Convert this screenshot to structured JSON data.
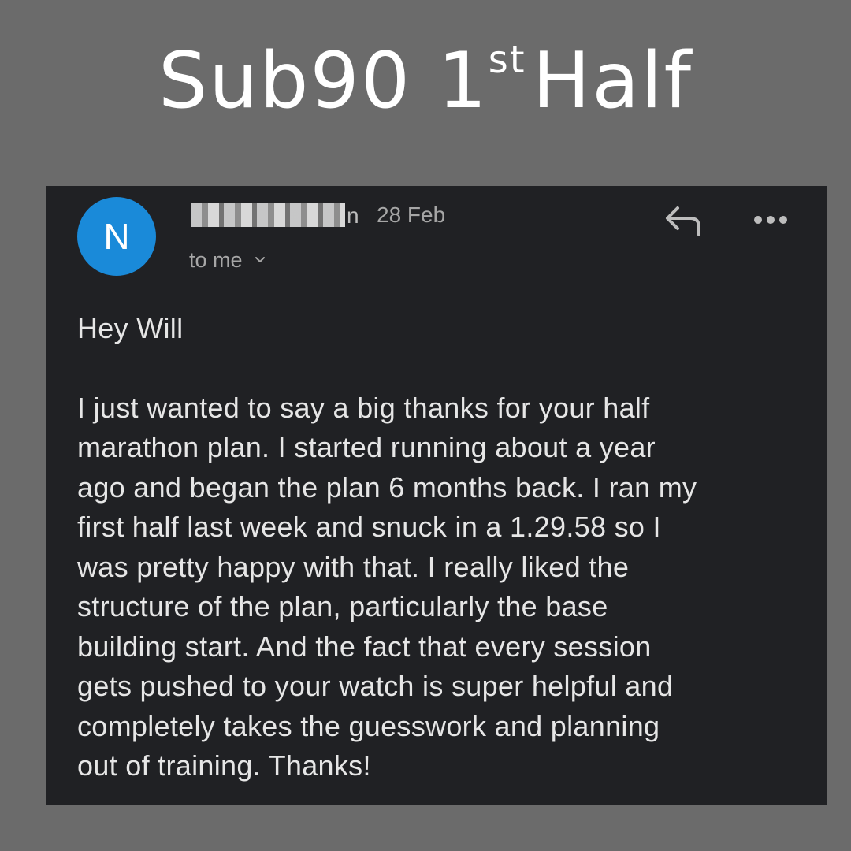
{
  "headline": {
    "main": "Sub90 1",
    "superscript": "st",
    "tail": "Half"
  },
  "email": {
    "avatar_initial": "N",
    "sender_visible_tail": "n",
    "date": "28 Feb",
    "recipient": "to me",
    "greeting": "Hey Will",
    "body_lines": [
      "I just wanted to say a big thanks for your half",
      "marathon plan. I started running about a year",
      "ago and began the plan 6 months back. I ran my",
      "first half last week and snuck in a 1.29.58 so I",
      "was pretty happy with that. I really liked the",
      "structure of the plan, particularly the base",
      "building start. And the fact that every session",
      "gets pushed to your watch is super helpful and",
      "completely takes the guesswork and planning",
      "out of training. Thanks!"
    ],
    "icons": {
      "reply": "reply-icon",
      "more": "more-options-icon",
      "chevron": "chevron-down-icon"
    },
    "colors": {
      "avatar": "#1a8ad9",
      "card_background": "#202124",
      "page_background": "#6b6b6b"
    }
  }
}
